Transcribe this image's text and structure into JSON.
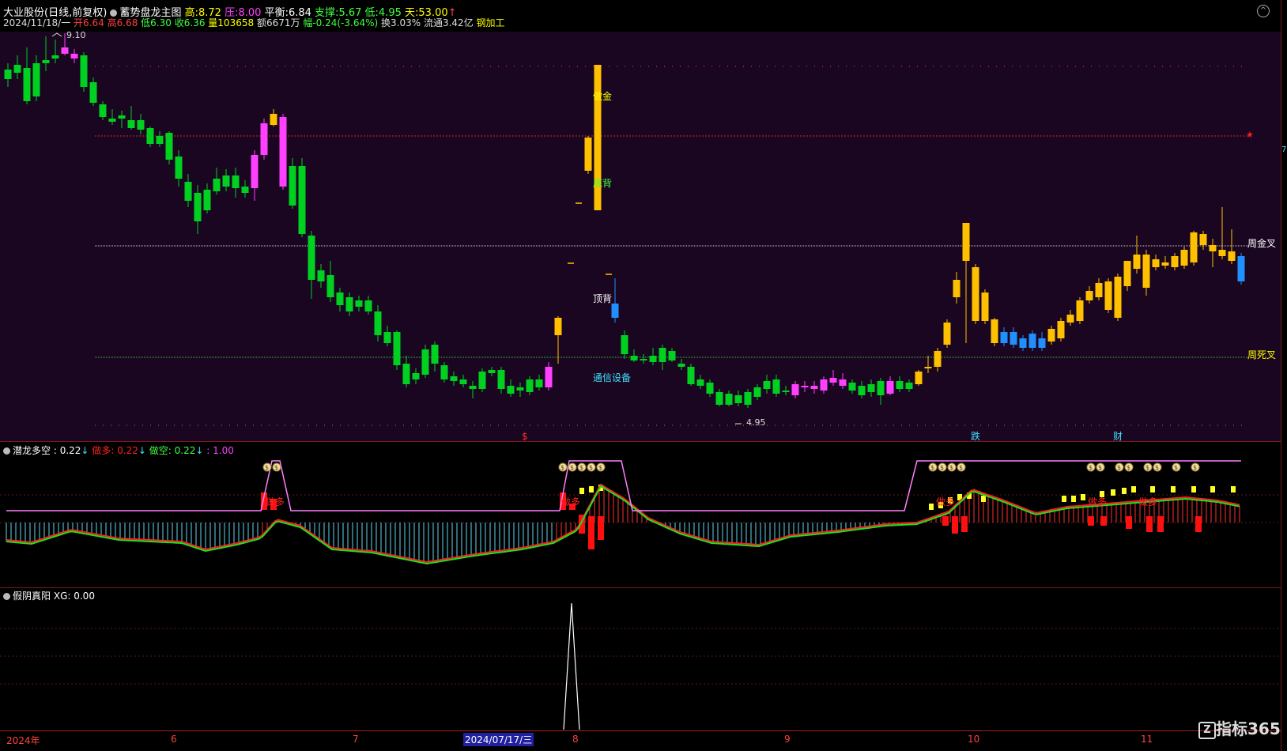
{
  "header": {
    "stock_name": "大业股份",
    "period_mode": "(日线,前复权)",
    "indicator_name": "蓄势盘龙主图",
    "high_label": "高:",
    "high_value": "8.72",
    "press_label": "压:",
    "press_value": "8.00",
    "balance_label": "平衡:",
    "balance_value": "6.84",
    "support_label": "支撑:",
    "support_value": "5.67",
    "low_label": "低:",
    "low_value": "4.95",
    "days_label": "天:",
    "days_value": "53.00",
    "info_date": "2024/11/18/一",
    "open_text": "开6.64",
    "high_text": "高6.68",
    "low_text": "低6.30",
    "close_text": "收6.36",
    "volume_text": "量103658",
    "amount_text": "额6671万",
    "change_text": "幅-0.24(-3.64%)",
    "turnover_text": "换3.03%",
    "float_text": "流通3.42亿",
    "industry_text": "钢加工"
  },
  "main_chart": {
    "max_label": "9.10",
    "min_label": "4.95",
    "annotations": [
      "做金",
      "底背",
      "顶背",
      "通信设备",
      "周金叉",
      "周死叉"
    ],
    "bottom_marks": [
      "$",
      "跌",
      "财"
    ],
    "star": "★"
  },
  "panel2": {
    "title": "潜龙多空",
    "value1": ": 0.22",
    "label2": "做多:",
    "value2": "0.22",
    "label3": "做空:",
    "value3": "0.22",
    "value4": ": 1.00",
    "labels": [
      "做多",
      "做多",
      "做多",
      "做多",
      "做多"
    ],
    "coin": "$"
  },
  "panel3": {
    "title": "假阴真阳",
    "label": "XG:",
    "value": "0.00"
  },
  "time_axis": {
    "labels": [
      "2024年",
      "6",
      "7",
      "2024/07/17/三",
      "8",
      "9",
      "10",
      "11"
    ]
  },
  "watermark": "指标365",
  "colors": {
    "up": "#ffc000",
    "down": "#00d020",
    "pink": "#ff40ff",
    "blue": "#2090ff",
    "cyan": "#40e0ff",
    "red": "#ff2020",
    "bg_main": "#1a0620"
  }
}
